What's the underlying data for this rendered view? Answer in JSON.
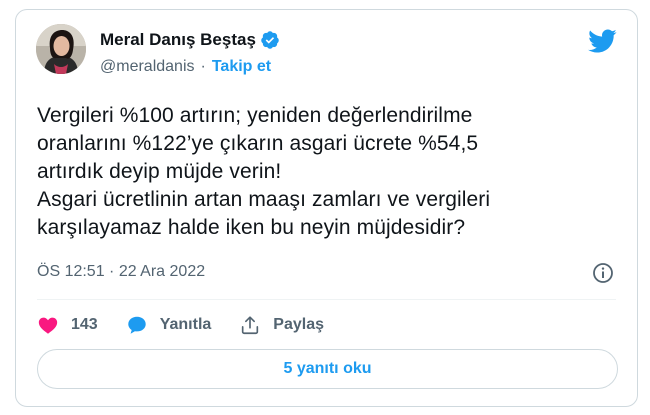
{
  "author": {
    "display_name": "Meral Danış Beştaş",
    "handle": "@meraldanis",
    "separator": "·",
    "follow_label": "Takip et",
    "verified": true
  },
  "tweet": {
    "lines": [
      "Vergileri %100 artırın; yeniden değerlendirilme",
      "oranlarını %122’ye çıkarın asgari ücrete %54,5",
      "artırdık deyip müjde verin!",
      "Asgari ücretlinin artan maaşı zamları ve vergileri",
      "karşılayamaz halde iken bu neyin müjdesidir?"
    ],
    "timestamp": "ÖS 12:51 · 22 Ara 2022"
  },
  "actions": {
    "like_count": "143",
    "reply_label": "Yanıtla",
    "share_label": "Paylaş"
  },
  "replies_button_label": "5 yanıtı oku",
  "colors": {
    "accent": "#1d9bf0",
    "like": "#f91880",
    "text": "#0f1419",
    "muted": "#536471",
    "border": "#cfd9de"
  },
  "icons": [
    "verified-badge-icon",
    "twitter-bird-icon",
    "info-icon",
    "heart-icon",
    "reply-bubble-icon",
    "share-icon"
  ]
}
